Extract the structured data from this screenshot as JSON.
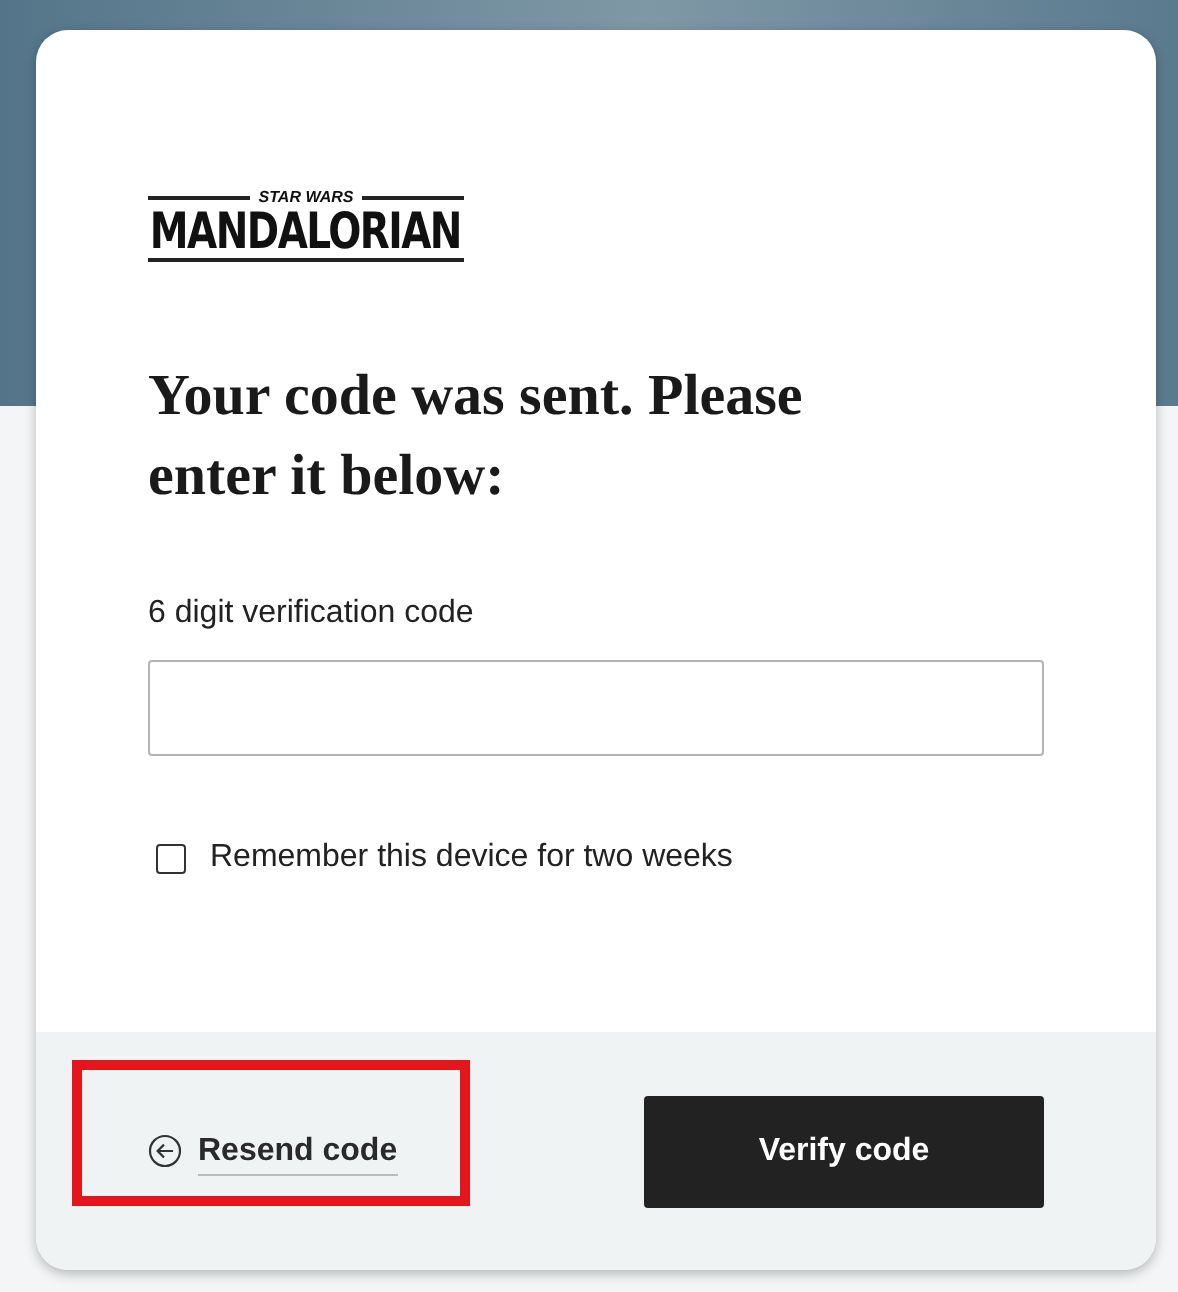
{
  "logo": {
    "tagline": "STAR WARS",
    "title": "MANDALORIAN"
  },
  "heading": "Your code was sent. Please enter it below:",
  "code_field": {
    "label": "6 digit verification code"
  },
  "remember_device": {
    "label": "Remember this device for two weeks",
    "checked": false
  },
  "resend_link": {
    "label": "Resend code",
    "highlighted": true
  },
  "verify_button": {
    "label": "Verify code"
  }
}
